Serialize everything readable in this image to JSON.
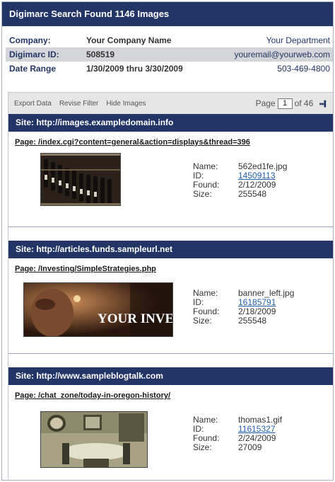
{
  "header": {
    "title": "Digimarc Search Found 1146 Images"
  },
  "info": {
    "rows": [
      {
        "label": "Company:",
        "value": "Your Company Name",
        "right": "Your Department"
      },
      {
        "label": "Digimarc ID:",
        "value": "508519",
        "right": "youremail@yourweb.com"
      },
      {
        "label": "Date Range",
        "value": "1/30/2009 thru 3/30/2009",
        "right": "503-469-4800"
      }
    ]
  },
  "toolbar": {
    "export_label": "Export Data",
    "revise_label": "Revise Filter",
    "hide_label": "Hide Images",
    "page_label": "Page",
    "page_value": "1",
    "of_label": "of 46",
    "next_last_glyph": "▸▸▌"
  },
  "results": [
    {
      "site": "Site:  http://images.exampledomain.info",
      "page": "Page:  /index.cgi?content=general&action=displays&thread=396",
      "name_label": "Name:",
      "name": "562ed1fe.jpg",
      "id_label": "ID:",
      "id": "14509113",
      "found_label": "Found:",
      "found": "2/12/2009",
      "size_label": "Size:",
      "size": "255548",
      "thumb_icon": "wine-shelf-photo"
    },
    {
      "site": "Site:  http://articles.funds.sampleurl.net",
      "page": "Page:  /Investing/SimpleStrategies.php",
      "name_label": "Name:",
      "name": "banner_left.jpg",
      "id_label": "ID:",
      "id": "16185791",
      "found_label": "Found:",
      "found": "2/18/2009",
      "size_label": "Size:",
      "size": "255548",
      "thumb_icon": "investing-banner-photo",
      "thumb_text": "YOUR INVESTI"
    },
    {
      "site": "Site:  http://www.sampleblogtalk.com",
      "page": "Page:  /chat_zone/today-in-oregon-history/",
      "name_label": "Name:",
      "name": "thomas1.gif",
      "id_label": "ID:",
      "id": "11615327",
      "found_label": "Found:",
      "found": "2/24/2009",
      "size_label": "Size:",
      "size": "27009",
      "thumb_icon": "dining-room-photo"
    }
  ]
}
